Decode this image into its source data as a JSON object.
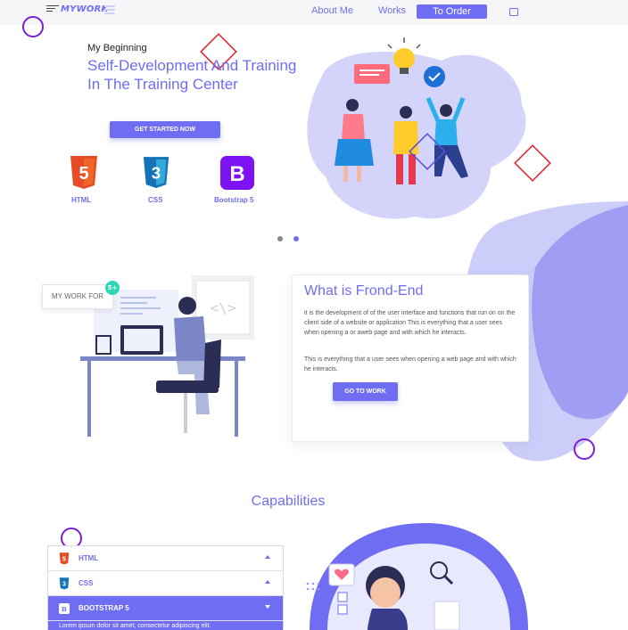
{
  "nav": {
    "logo": "MYWORK",
    "links": [
      "About Me",
      "Works"
    ],
    "order_label": "To Order"
  },
  "hero": {
    "kicker": "My Beginning",
    "title": "Self-Development And Training In The Training Center",
    "cta_label": "GET STARTED NOW",
    "techs": [
      {
        "label": "HTML",
        "icon": "html5-icon",
        "glyph": "5"
      },
      {
        "label": "CSS",
        "icon": "css3-icon",
        "glyph": "3"
      },
      {
        "label": "Bootstrap 5",
        "icon": "bootstrap-icon",
        "glyph": "B"
      }
    ]
  },
  "carousel": {
    "slides": 2,
    "active": 2
  },
  "about": {
    "mywork_label": "MY WORK FOR",
    "badge": "5+",
    "title": "What is Frond-End",
    "paragraph_1": "it is the development of of the user interface and functions that run on on the client side of a website or application This is everything that a user sees when opening a or aweb page and with which he interacts.",
    "paragraph_2": "This is everything that a user sees when opening a web page and with which he interacts.",
    "cta_label": "GO TO WORK",
    "code_glyph": "<\\>"
  },
  "capabilities": {
    "title": "Capabilities",
    "items": [
      {
        "label": "HTML",
        "glyph": "5",
        "active": false
      },
      {
        "label": "CSS",
        "glyph": "3",
        "active": false
      },
      {
        "label": "BOOTSTRAP 5",
        "glyph": "B",
        "active": true
      }
    ],
    "active_body": "Lorem ipsum dolor sit amet, consectetur adipiscing elit."
  },
  "colors": {
    "accent": "#6f6df2",
    "accent_light": "#d4d4fb",
    "html_orange": "#e44d26",
    "css_blue": "#1572b6",
    "bootstrap_purple": "#7d12f2",
    "decor_red": "#e0202c",
    "decor_purple": "#7a1fd6"
  }
}
